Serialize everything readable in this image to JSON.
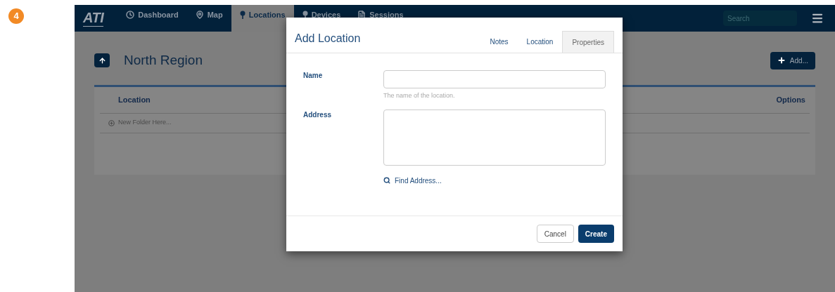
{
  "step_badge": "4",
  "navbar": {
    "logo": "ATI",
    "items": [
      {
        "label": "Dashboard",
        "kind": "clock",
        "selected": false
      },
      {
        "label": "Map",
        "kind": "pin",
        "selected": false
      },
      {
        "label": "Locations",
        "kind": "marker",
        "selected": true
      },
      {
        "label": "Devices",
        "kind": "marker",
        "selected": false
      },
      {
        "label": "Sessions",
        "kind": "doc",
        "selected": false
      }
    ],
    "search": {
      "placeholder": "Search"
    }
  },
  "page": {
    "title": "North Region",
    "add_button": "Add...",
    "table": {
      "columns": [
        "Location",
        "Options"
      ],
      "rows": [
        {
          "label": "New Folder Here..."
        }
      ]
    }
  },
  "dialog": {
    "title": "Add Location",
    "tabs": [
      {
        "label": "Notes",
        "selected": false
      },
      {
        "label": "Location",
        "selected": false
      },
      {
        "label": "Properties",
        "selected": true
      }
    ],
    "fields": [
      {
        "label": "Name",
        "kind": "input",
        "help": "The name of the location."
      },
      {
        "label": "Address",
        "kind": "textarea"
      }
    ],
    "find_link": "Find Address...",
    "buttons": [
      {
        "label": "Cancel",
        "kind": "default"
      },
      {
        "label": "Create",
        "kind": "primary"
      }
    ]
  }
}
